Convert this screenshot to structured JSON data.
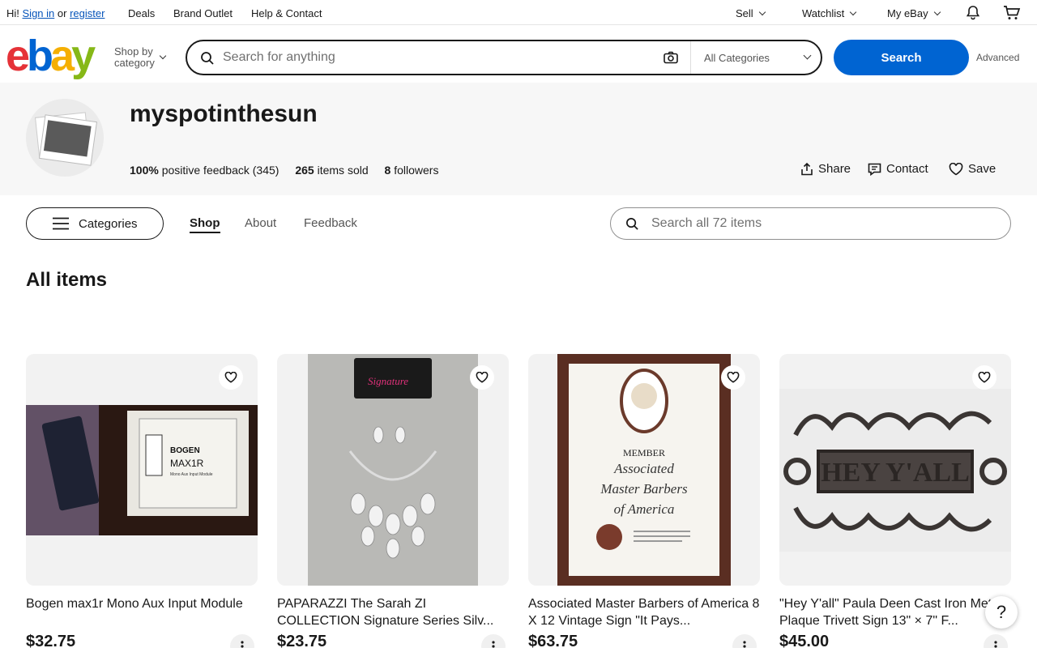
{
  "topbar": {
    "greeting": "Hi!",
    "signin": "Sign in",
    "or": "or",
    "register": "register",
    "deals": "Deals",
    "brand_outlet": "Brand Outlet",
    "help_contact": "Help & Contact",
    "sell": "Sell",
    "watchlist": "Watchlist",
    "my_ebay": "My eBay"
  },
  "header": {
    "logo_letters": [
      "e",
      "b",
      "a",
      "y"
    ],
    "logo_colors": [
      "#e53238",
      "#0064d2",
      "#f5af02",
      "#86b817"
    ],
    "shop_by_line1": "Shop by",
    "shop_by_line2": "category",
    "search_placeholder": "Search for anything",
    "category_select": "All Categories",
    "search_button": "Search",
    "advanced": "Advanced",
    "accent": "#0064d2"
  },
  "store": {
    "name": "myspotinthesun",
    "feedback_pct": "100%",
    "feedback_text": "positive feedback (345)",
    "sold_count": "265",
    "sold_text": "items sold",
    "followers_count": "8",
    "followers_text": "followers",
    "share": "Share",
    "contact": "Contact",
    "save": "Save"
  },
  "storenav": {
    "categories": "Categories",
    "tabs": [
      "Shop",
      "About",
      "Feedback"
    ],
    "active_tab": "Shop",
    "search_placeholder": "Search all 72 items"
  },
  "section_title": "All items",
  "items": [
    {
      "title": "Bogen max1r Mono Aux Input Module",
      "price": "$32.75",
      "image": "Bogen MAX1R module photo"
    },
    {
      "title": "PAPARAZZI The Sarah ZI COLLECTION Signature Series Silv...",
      "price": "$23.75",
      "image": "Signature necklace and earrings"
    },
    {
      "title": "Associated Master Barbers of America 8 X 12 Vintage Sign \"It Pays...",
      "price": "$63.75",
      "image": "Master Barbers plaque"
    },
    {
      "title": "\"Hey Y'all\" Paula Deen Cast Iron Metal Plaque Trivett Sign 13\" × 7\" F...",
      "price": "$45.00",
      "image": "HEY Y'ALL cast iron plaque"
    }
  ],
  "item_image_text": {
    "bogen_brand": "BOGEN",
    "bogen_model": "MAX1R",
    "bogen_sub": "Mono Aux Input Module",
    "signature": "Signature",
    "plaque_member": "MEMBER",
    "plaque_line1": "Associated",
    "plaque_line2": "Master Barbers",
    "plaque_line3": "of America",
    "trivet": "HEY Y'ALL"
  },
  "help_button": "?"
}
